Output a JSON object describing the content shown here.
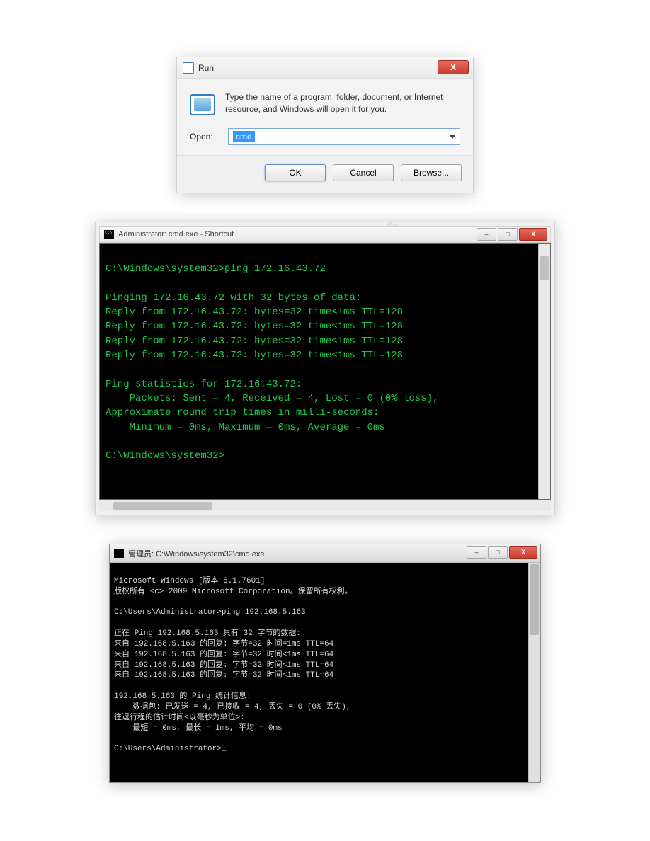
{
  "run": {
    "title": "Run",
    "desc": "Type the name of a program, folder, document, or Internet resource, and Windows will open it for you.",
    "open_label": "Open:",
    "input_value": "cmd",
    "btn_ok": "OK",
    "btn_cancel": "Cancel",
    "btn_browse": "Browse...",
    "close_x": "X"
  },
  "cmd1": {
    "title": "Administrator: cmd.exe - Shortcut",
    "lines": [
      "C:\\Windows\\system32>ping 172.16.43.72",
      "",
      "Pinging 172.16.43.72 with 32 bytes of data:",
      "Reply from 172.16.43.72: bytes=32 time<1ms TTL=128",
      "Reply from 172.16.43.72: bytes=32 time<1ms TTL=128",
      "Reply from 172.16.43.72: bytes=32 time<1ms TTL=128",
      "Reply from 172.16.43.72: bytes=32 time<1ms TTL=128",
      "",
      "Ping statistics for 172.16.43.72:",
      "    Packets: Sent = 4, Received = 4, Lost = 0 (0% loss),",
      "Approximate round trip times in milli-seconds:",
      "    Minimum = 0ms, Maximum = 0ms, Average = 0ms",
      "",
      "C:\\Windows\\system32>_"
    ],
    "min_sym": "–",
    "max_sym": "□",
    "close_x": "X"
  },
  "cmd2": {
    "title": "管理员: C:\\Windows\\system32\\cmd.exe",
    "lines": [
      "Microsoft Windows [版本 6.1.7601]",
      "版权所有 <c> 2009 Microsoft Corporation。保留所有权利。",
      "",
      "C:\\Users\\Administrator>ping 192.168.5.163",
      "",
      "正在 Ping 192.168.5.163 具有 32 字节的数据:",
      "来自 192.168.5.163 的回复: 字节=32 时间=1ms TTL=64",
      "来自 192.168.5.163 的回复: 字节=32 时间<1ms TTL=64",
      "来自 192.168.5.163 的回复: 字节=32 时间<1ms TTL=64",
      "来自 192.168.5.163 的回复: 字节=32 时间<1ms TTL=64",
      "",
      "192.168.5.163 的 Ping 统计信息:",
      "    数据包: 已发送 = 4, 已接收 = 4, 丢失 = 0 (0% 丢失),",
      "往返行程的估计时间<以毫秒为单位>:",
      "    最短 = 0ms, 最长 = 1ms, 平均 = 0ms",
      "",
      "C:\\Users\\Administrator>_"
    ],
    "min_sym": "–",
    "max_sym": "□",
    "close_x": "X"
  }
}
